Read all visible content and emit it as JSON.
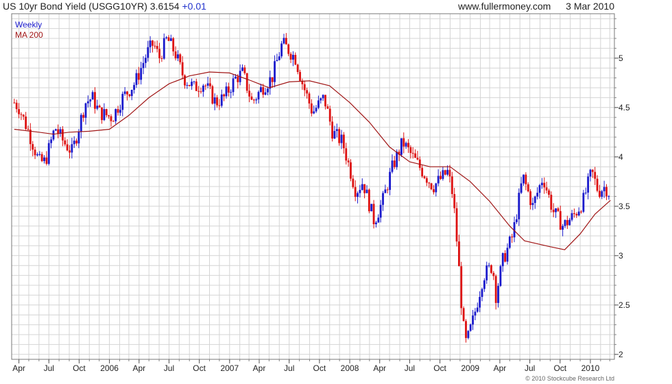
{
  "header": {
    "title": "US 10yr Bond Yield (USGG10YR)",
    "last": "3.6154",
    "change": "+0.01",
    "site": "www.fullermoney.com",
    "date": "3 Mar 2010"
  },
  "legend": {
    "weekly": "Weekly",
    "ma": "MA 200"
  },
  "copyright": "© 2010 Stockcube Research Ltd",
  "colors": {
    "up": "#1a1acc",
    "down": "#dd1111",
    "ma": "#a01515",
    "grid": "#d4d4d4",
    "axis": "#888888"
  },
  "chart_data": {
    "type": "candlestick",
    "title": "US 10yr Bond Yield (USGG10YR)",
    "frequency": "weekly",
    "y_axis_side": "right",
    "ylim": [
      1.95,
      5.45
    ],
    "y_ticks": [
      2,
      2.5,
      3,
      3.5,
      4,
      4.5,
      5
    ],
    "grid": true,
    "x_tick_labels": [
      "Apr",
      "Jul",
      "Oct",
      "2006",
      "Apr",
      "Jul",
      "Oct",
      "2007",
      "Apr",
      "Jul",
      "Oct",
      "2008",
      "Apr",
      "Jul",
      "Oct",
      "2009",
      "Apr",
      "Jul",
      "Oct",
      "2010"
    ],
    "x_tick_dates": [
      "2005-04-01",
      "2005-07-01",
      "2005-10-01",
      "2006-01-01",
      "2006-04-01",
      "2006-07-01",
      "2006-10-01",
      "2007-01-01",
      "2007-04-01",
      "2007-07-01",
      "2007-10-01",
      "2008-01-01",
      "2008-04-01",
      "2008-07-01",
      "2008-10-01",
      "2009-01-01",
      "2009-04-01",
      "2009-07-01",
      "2009-10-01",
      "2010-01-01"
    ],
    "xlim": [
      "2005-03-10",
      "2010-03-15"
    ],
    "series": [
      {
        "name": "Weekly",
        "kind": "ohlc",
        "anchors": [
          [
            "2005-03-18",
            4.55
          ],
          [
            "2005-04-01",
            4.5
          ],
          [
            "2005-05-01",
            4.25
          ],
          [
            "2005-06-01",
            3.95
          ],
          [
            "2005-06-20",
            3.95
          ],
          [
            "2005-07-20",
            4.3
          ],
          [
            "2005-08-15",
            4.15
          ],
          [
            "2005-09-10",
            4.05
          ],
          [
            "2005-10-20",
            4.55
          ],
          [
            "2005-11-10",
            4.6
          ],
          [
            "2005-12-01",
            4.45
          ],
          [
            "2006-01-10",
            4.4
          ],
          [
            "2006-02-10",
            4.6
          ],
          [
            "2006-03-20",
            4.75
          ],
          [
            "2006-04-25",
            5.05
          ],
          [
            "2006-05-15",
            5.15
          ],
          [
            "2006-06-01",
            5.0
          ],
          [
            "2006-06-25",
            5.2
          ],
          [
            "2006-07-20",
            5.05
          ],
          [
            "2006-08-15",
            4.8
          ],
          [
            "2006-09-15",
            4.7
          ],
          [
            "2006-10-15",
            4.75
          ],
          [
            "2006-11-20",
            4.55
          ],
          [
            "2006-12-15",
            4.6
          ],
          [
            "2007-01-20",
            4.8
          ],
          [
            "2007-02-10",
            4.85
          ],
          [
            "2007-03-10",
            4.55
          ],
          [
            "2007-04-10",
            4.7
          ],
          [
            "2007-05-10",
            4.8
          ],
          [
            "2007-06-10",
            5.15
          ],
          [
            "2007-06-25",
            5.1
          ],
          [
            "2007-07-20",
            5.0
          ],
          [
            "2007-08-10",
            4.75
          ],
          [
            "2007-09-10",
            4.45
          ],
          [
            "2007-10-15",
            4.6
          ],
          [
            "2007-11-10",
            4.25
          ],
          [
            "2007-12-10",
            4.15
          ],
          [
            "2008-01-20",
            3.65
          ],
          [
            "2008-02-10",
            3.75
          ],
          [
            "2008-03-15",
            3.35
          ],
          [
            "2008-04-10",
            3.55
          ],
          [
            "2008-05-10",
            3.9
          ],
          [
            "2008-06-10",
            4.15
          ],
          [
            "2008-07-10",
            4.0
          ],
          [
            "2008-08-10",
            3.85
          ],
          [
            "2008-09-10",
            3.7
          ],
          [
            "2008-10-10",
            3.8
          ],
          [
            "2008-10-25",
            3.85
          ],
          [
            "2008-11-10",
            3.6
          ],
          [
            "2008-11-25",
            3.0
          ],
          [
            "2008-12-10",
            2.3
          ],
          [
            "2008-12-20",
            2.1
          ],
          [
            "2009-01-10",
            2.35
          ],
          [
            "2009-02-10",
            2.8
          ],
          [
            "2009-03-10",
            2.9
          ],
          [
            "2009-03-20",
            2.6
          ],
          [
            "2009-04-10",
            2.95
          ],
          [
            "2009-05-10",
            3.2
          ],
          [
            "2009-06-10",
            3.8
          ],
          [
            "2009-07-10",
            3.5
          ],
          [
            "2009-08-10",
            3.8
          ],
          [
            "2009-09-10",
            3.45
          ],
          [
            "2009-10-10",
            3.3
          ],
          [
            "2009-11-10",
            3.4
          ],
          [
            "2009-12-10",
            3.55
          ],
          [
            "2010-01-05",
            3.85
          ],
          [
            "2010-01-25",
            3.65
          ],
          [
            "2010-02-15",
            3.7
          ],
          [
            "2010-03-03",
            3.6154
          ]
        ]
      },
      {
        "name": "MA 200",
        "kind": "line",
        "points": [
          [
            "2005-03-18",
            4.28
          ],
          [
            "2005-06-01",
            4.25
          ],
          [
            "2005-07-15",
            4.23
          ],
          [
            "2005-09-01",
            4.25
          ],
          [
            "2005-11-01",
            4.26
          ],
          [
            "2006-01-01",
            4.28
          ],
          [
            "2006-03-01",
            4.42
          ],
          [
            "2006-05-01",
            4.6
          ],
          [
            "2006-07-01",
            4.74
          ],
          [
            "2006-09-01",
            4.82
          ],
          [
            "2006-11-01",
            4.86
          ],
          [
            "2007-01-01",
            4.85
          ],
          [
            "2007-03-01",
            4.78
          ],
          [
            "2007-05-01",
            4.7
          ],
          [
            "2007-07-01",
            4.76
          ],
          [
            "2007-09-01",
            4.77
          ],
          [
            "2007-11-01",
            4.72
          ],
          [
            "2008-01-01",
            4.55
          ],
          [
            "2008-03-01",
            4.35
          ],
          [
            "2008-05-01",
            4.1
          ],
          [
            "2008-07-01",
            3.95
          ],
          [
            "2008-09-01",
            3.9
          ],
          [
            "2008-11-01",
            3.9
          ],
          [
            "2009-01-01",
            3.75
          ],
          [
            "2009-03-01",
            3.55
          ],
          [
            "2009-05-01",
            3.3
          ],
          [
            "2009-06-15",
            3.15
          ],
          [
            "2009-09-01",
            3.09
          ],
          [
            "2009-10-15",
            3.06
          ],
          [
            "2009-12-01",
            3.22
          ],
          [
            "2010-01-15",
            3.42
          ],
          [
            "2010-03-03",
            3.56
          ]
        ]
      }
    ]
  }
}
